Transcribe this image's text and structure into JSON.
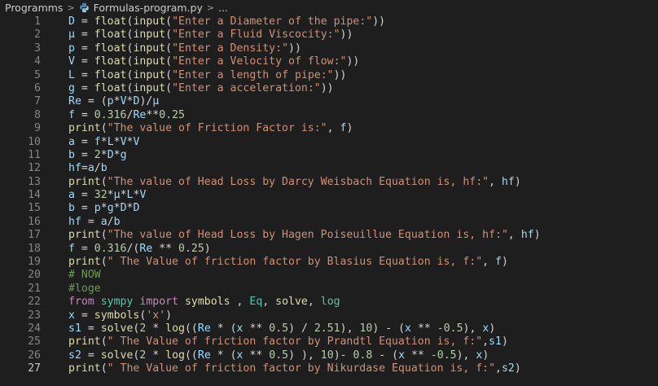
{
  "breadcrumb": {
    "folder": "Programms",
    "file": "Formulas-program.py",
    "trail": "..."
  },
  "icons": {
    "separator": "chevron-right-icon",
    "file": "python-file-icon"
  },
  "colors": {
    "background": "#1e1e1e",
    "line_number": "#858585",
    "variable": "#9cdcfe",
    "function": "#dcdcaa",
    "string": "#ce9178",
    "number": "#b5cea8",
    "keyword": "#c586c0",
    "comment": "#6a9955"
  },
  "editor": {
    "active_line": 27,
    "lines": [
      {
        "num": "1",
        "tokens": [
          [
            "v",
            "D"
          ],
          [
            "o",
            " = "
          ],
          [
            "f",
            "float"
          ],
          [
            "o",
            "("
          ],
          [
            "f",
            "input"
          ],
          [
            "o",
            "("
          ],
          [
            "s",
            "\"Enter a Diameter of the pipe:\""
          ],
          [
            "o",
            "))"
          ]
        ]
      },
      {
        "num": "2",
        "tokens": [
          [
            "v",
            "μ"
          ],
          [
            "o",
            " = "
          ],
          [
            "f",
            "float"
          ],
          [
            "o",
            "("
          ],
          [
            "f",
            "input"
          ],
          [
            "o",
            "("
          ],
          [
            "s",
            "\"Enter a Fluid Viscocity:\""
          ],
          [
            "o",
            "))"
          ]
        ]
      },
      {
        "num": "3",
        "tokens": [
          [
            "v",
            "p"
          ],
          [
            "o",
            " = "
          ],
          [
            "f",
            "float"
          ],
          [
            "o",
            "("
          ],
          [
            "f",
            "input"
          ],
          [
            "o",
            "("
          ],
          [
            "s",
            "\"Enter a Density:\""
          ],
          [
            "o",
            "))"
          ]
        ]
      },
      {
        "num": "4",
        "tokens": [
          [
            "v",
            "V"
          ],
          [
            "o",
            " = "
          ],
          [
            "f",
            "float"
          ],
          [
            "o",
            "("
          ],
          [
            "f",
            "input"
          ],
          [
            "o",
            "("
          ],
          [
            "s",
            "\"Enter a Velocity of flow:\""
          ],
          [
            "o",
            "))"
          ]
        ]
      },
      {
        "num": "5",
        "tokens": [
          [
            "v",
            "L"
          ],
          [
            "o",
            " = "
          ],
          [
            "f",
            "float"
          ],
          [
            "o",
            "("
          ],
          [
            "f",
            "input"
          ],
          [
            "o",
            "("
          ],
          [
            "s",
            "\"Enter a length of pipe:\""
          ],
          [
            "o",
            "))"
          ]
        ]
      },
      {
        "num": "6",
        "tokens": [
          [
            "v",
            "g"
          ],
          [
            "o",
            " = "
          ],
          [
            "f",
            "float"
          ],
          [
            "o",
            "("
          ],
          [
            "f",
            "input"
          ],
          [
            "o",
            "("
          ],
          [
            "s",
            "\"Enter a acceleration:\""
          ],
          [
            "o",
            "))"
          ]
        ]
      },
      {
        "num": "7",
        "tokens": [
          [
            "v",
            "Re"
          ],
          [
            "o",
            " = "
          ],
          [
            "o",
            "("
          ],
          [
            "v",
            "p"
          ],
          [
            "o",
            "*"
          ],
          [
            "v",
            "V"
          ],
          [
            "o",
            "*"
          ],
          [
            "v",
            "D"
          ],
          [
            "o",
            ")/"
          ],
          [
            "v",
            "μ"
          ]
        ]
      },
      {
        "num": "8",
        "tokens": [
          [
            "v",
            "f"
          ],
          [
            "o",
            " = "
          ],
          [
            "n",
            "0.316"
          ],
          [
            "o",
            "/"
          ],
          [
            "v",
            "Re"
          ],
          [
            "o",
            "**"
          ],
          [
            "n",
            "0.25"
          ]
        ]
      },
      {
        "num": "9",
        "tokens": [
          [
            "f",
            "print"
          ],
          [
            "o",
            "("
          ],
          [
            "s",
            "\"The value of Friction Factor is:\""
          ],
          [
            "o",
            ", "
          ],
          [
            "v",
            "f"
          ],
          [
            "o",
            ")"
          ]
        ]
      },
      {
        "num": "10",
        "tokens": [
          [
            "v",
            "a"
          ],
          [
            "o",
            " = "
          ],
          [
            "v",
            "f"
          ],
          [
            "o",
            "*"
          ],
          [
            "v",
            "L"
          ],
          [
            "o",
            "*"
          ],
          [
            "v",
            "V"
          ],
          [
            "o",
            "*"
          ],
          [
            "v",
            "V"
          ]
        ]
      },
      {
        "num": "11",
        "tokens": [
          [
            "v",
            "b"
          ],
          [
            "o",
            " = "
          ],
          [
            "n",
            "2"
          ],
          [
            "o",
            "*"
          ],
          [
            "v",
            "D"
          ],
          [
            "o",
            "*"
          ],
          [
            "v",
            "g"
          ]
        ]
      },
      {
        "num": "12",
        "tokens": [
          [
            "v",
            "hf"
          ],
          [
            "o",
            "="
          ],
          [
            "v",
            "a"
          ],
          [
            "o",
            "/"
          ],
          [
            "v",
            "b"
          ]
        ]
      },
      {
        "num": "13",
        "tokens": [
          [
            "f",
            "print"
          ],
          [
            "o",
            "("
          ],
          [
            "s",
            "\"The value of Head Loss by Darcy Weisbach Equation is, hf:\""
          ],
          [
            "o",
            ", "
          ],
          [
            "v",
            "hf"
          ],
          [
            "o",
            ")"
          ]
        ]
      },
      {
        "num": "14",
        "tokens": [
          [
            "v",
            "a"
          ],
          [
            "o",
            " = "
          ],
          [
            "n",
            "32"
          ],
          [
            "o",
            "*"
          ],
          [
            "v",
            "μ"
          ],
          [
            "o",
            "*"
          ],
          [
            "v",
            "L"
          ],
          [
            "o",
            "*"
          ],
          [
            "v",
            "V"
          ]
        ]
      },
      {
        "num": "15",
        "tokens": [
          [
            "v",
            "b"
          ],
          [
            "o",
            " = "
          ],
          [
            "v",
            "p"
          ],
          [
            "o",
            "*"
          ],
          [
            "v",
            "g"
          ],
          [
            "o",
            "*"
          ],
          [
            "v",
            "D"
          ],
          [
            "o",
            "*"
          ],
          [
            "v",
            "D"
          ]
        ]
      },
      {
        "num": "16",
        "tokens": [
          [
            "v",
            "hf"
          ],
          [
            "o",
            " = "
          ],
          [
            "v",
            "a"
          ],
          [
            "o",
            "/"
          ],
          [
            "v",
            "b"
          ]
        ]
      },
      {
        "num": "17",
        "tokens": [
          [
            "f",
            "print"
          ],
          [
            "o",
            "("
          ],
          [
            "s",
            "\"The value of Head Loss by Hagen Poiseuillue Equation is, hf:\""
          ],
          [
            "o",
            ", "
          ],
          [
            "v",
            "hf"
          ],
          [
            "o",
            ")"
          ]
        ]
      },
      {
        "num": "18",
        "tokens": [
          [
            "v",
            "f"
          ],
          [
            "o",
            " = "
          ],
          [
            "n",
            "0.316"
          ],
          [
            "o",
            "/("
          ],
          [
            "v",
            "Re"
          ],
          [
            "o",
            " ** "
          ],
          [
            "n",
            "0.25"
          ],
          [
            "o",
            ")"
          ]
        ]
      },
      {
        "num": "19",
        "tokens": [
          [
            "f",
            "print"
          ],
          [
            "o",
            "("
          ],
          [
            "s",
            "\" The Value of friction factor by Blasius Equation is, f:\""
          ],
          [
            "o",
            ", "
          ],
          [
            "v",
            "f"
          ],
          [
            "o",
            ")"
          ]
        ]
      },
      {
        "num": "20",
        "tokens": [
          [
            "c",
            "# NOW"
          ]
        ]
      },
      {
        "num": "21",
        "tokens": [
          [
            "c",
            "#loge"
          ]
        ]
      },
      {
        "num": "22",
        "tokens": [
          [
            "k",
            "from"
          ],
          [
            "o",
            " "
          ],
          [
            "t",
            "sympy"
          ],
          [
            "o",
            " "
          ],
          [
            "k",
            "import"
          ],
          [
            "o",
            " "
          ],
          [
            "f",
            "symbols"
          ],
          [
            "o",
            " , "
          ],
          [
            "t",
            "Eq"
          ],
          [
            "o",
            ", "
          ],
          [
            "f",
            "solve"
          ],
          [
            "o",
            ", "
          ],
          [
            "t",
            "log"
          ]
        ]
      },
      {
        "num": "23",
        "tokens": [
          [
            "v",
            "x"
          ],
          [
            "o",
            " = "
          ],
          [
            "f",
            "symbols"
          ],
          [
            "o",
            "("
          ],
          [
            "s",
            "'x'"
          ],
          [
            "o",
            ")"
          ]
        ]
      },
      {
        "num": "24",
        "tokens": [
          [
            "v",
            "s1"
          ],
          [
            "o",
            " = "
          ],
          [
            "f",
            "solve"
          ],
          [
            "o",
            "("
          ],
          [
            "n",
            "2"
          ],
          [
            "o",
            " * "
          ],
          [
            "f",
            "log"
          ],
          [
            "o",
            "(("
          ],
          [
            "v",
            "Re"
          ],
          [
            "o",
            " * "
          ],
          [
            "o",
            "("
          ],
          [
            "v",
            "x"
          ],
          [
            "o",
            " ** "
          ],
          [
            "n",
            "0.5"
          ],
          [
            "o",
            ") / "
          ],
          [
            "n",
            "2.51"
          ],
          [
            "o",
            "), "
          ],
          [
            "n",
            "10"
          ],
          [
            "o",
            ") - ("
          ],
          [
            "v",
            "x"
          ],
          [
            "o",
            " ** "
          ],
          [
            "n",
            "-0.5"
          ],
          [
            "o",
            "), "
          ],
          [
            "v",
            "x"
          ],
          [
            "o",
            ")"
          ]
        ]
      },
      {
        "num": "25",
        "tokens": [
          [
            "f",
            "print"
          ],
          [
            "o",
            "("
          ],
          [
            "s",
            "\" The Value of friction factor by Prandtl Equation is, f:\""
          ],
          [
            "o",
            ","
          ],
          [
            "v",
            "s1"
          ],
          [
            "o",
            ")"
          ]
        ]
      },
      {
        "num": "26",
        "tokens": [
          [
            "v",
            "s2"
          ],
          [
            "o",
            " = "
          ],
          [
            "f",
            "solve"
          ],
          [
            "o",
            "("
          ],
          [
            "n",
            "2"
          ],
          [
            "o",
            " * "
          ],
          [
            "f",
            "log"
          ],
          [
            "o",
            "(("
          ],
          [
            "v",
            "Re"
          ],
          [
            "o",
            " * "
          ],
          [
            "o",
            "("
          ],
          [
            "v",
            "x"
          ],
          [
            "o",
            " ** "
          ],
          [
            "n",
            "0.5"
          ],
          [
            "o",
            ") ), "
          ],
          [
            "n",
            "10"
          ],
          [
            "o",
            ")- "
          ],
          [
            "n",
            "0.8"
          ],
          [
            "o",
            " - ("
          ],
          [
            "v",
            "x"
          ],
          [
            "o",
            " ** "
          ],
          [
            "n",
            "-0.5"
          ],
          [
            "o",
            "), "
          ],
          [
            "v",
            "x"
          ],
          [
            "o",
            ")"
          ]
        ]
      },
      {
        "num": "27",
        "tokens": [
          [
            "f",
            "print"
          ],
          [
            "o",
            "("
          ],
          [
            "s",
            "\" The Value of friction factor by Nikurdase Equation is, f:\""
          ],
          [
            "o",
            ","
          ],
          [
            "v",
            "s2"
          ],
          [
            "o",
            ")"
          ]
        ]
      }
    ]
  }
}
